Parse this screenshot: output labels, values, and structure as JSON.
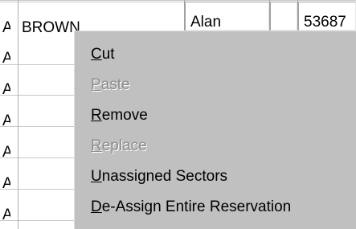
{
  "table": {
    "row_prefix": "A",
    "rows": [
      {
        "prefix": "A",
        "last_name": "BROWN",
        "first_name": "Alan",
        "number": "53687"
      },
      {
        "prefix": "A"
      },
      {
        "prefix": "A"
      },
      {
        "prefix": "A"
      },
      {
        "prefix": "A"
      },
      {
        "prefix": "A"
      },
      {
        "prefix": "A"
      }
    ]
  },
  "context_menu": {
    "items": [
      {
        "label": "Cut",
        "mnemonic": "C",
        "rest": "ut",
        "enabled": true
      },
      {
        "label": "Paste",
        "mnemonic": "P",
        "rest": "aste",
        "enabled": false
      },
      {
        "label": "Remove",
        "mnemonic": "R",
        "rest": "emove",
        "enabled": true
      },
      {
        "label": "Replace",
        "mnemonic": "R",
        "rest": "eplace",
        "enabled": false
      },
      {
        "label": "Unassigned Sectors",
        "mnemonic": "U",
        "rest": "nassigned Sectors",
        "enabled": true
      },
      {
        "label": "De-Assign Entire Reservation",
        "mnemonic": "D",
        "rest": "e-Assign Entire Reservation",
        "enabled": true
      }
    ]
  },
  "colors": {
    "menu_background": "#c0c0c0",
    "disabled_text": "#8c8c8c",
    "grid_line": "#c8c8c8"
  }
}
